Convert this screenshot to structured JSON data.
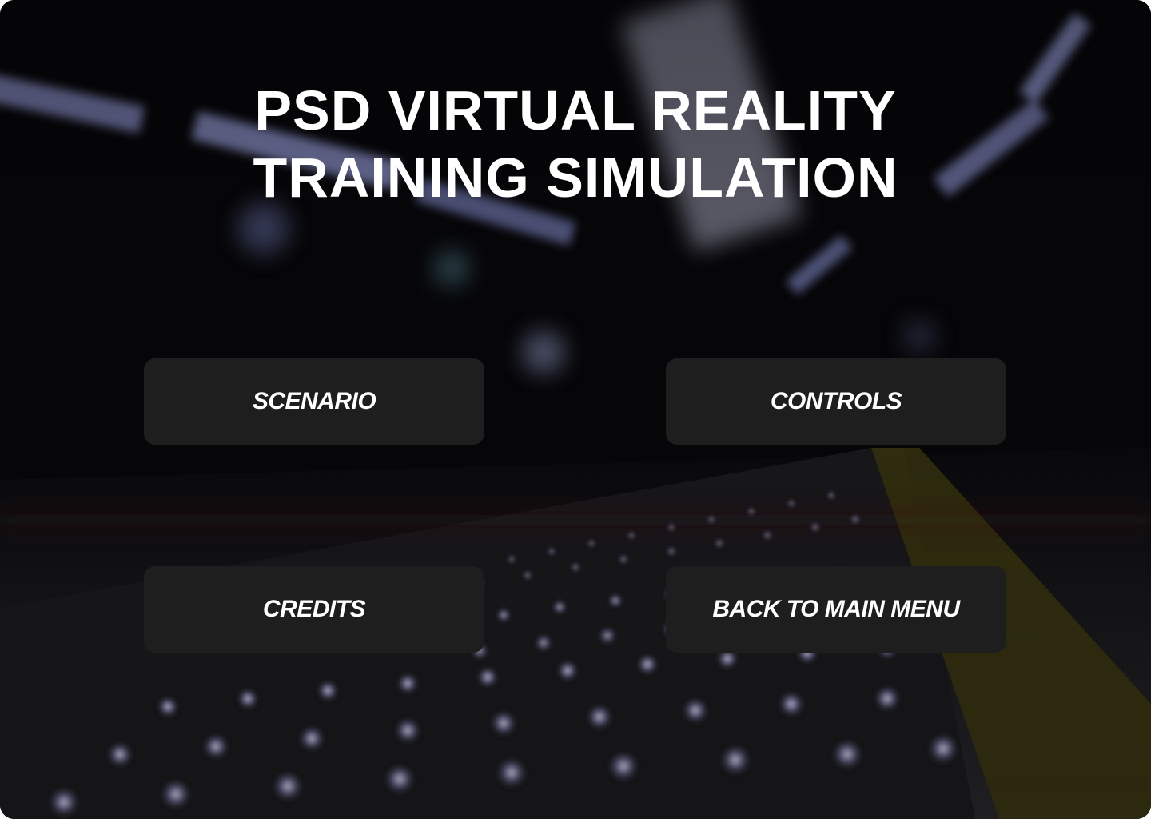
{
  "title": {
    "line1": "PSD VIRTUAL REALITY",
    "line2": "TRAINING SIMULATION"
  },
  "menu": {
    "scenario_label": "SCENARIO",
    "controls_label": "CONTROLS",
    "credits_label": "CREDITS",
    "back_label": "BACK TO MAIN MENU"
  },
  "colors": {
    "background": "#07070a",
    "button_bg": "#1e1e1f",
    "text": "#ffffff",
    "tactile_strip": "#4a4414",
    "ceiling_light": "#8a8fc0"
  }
}
